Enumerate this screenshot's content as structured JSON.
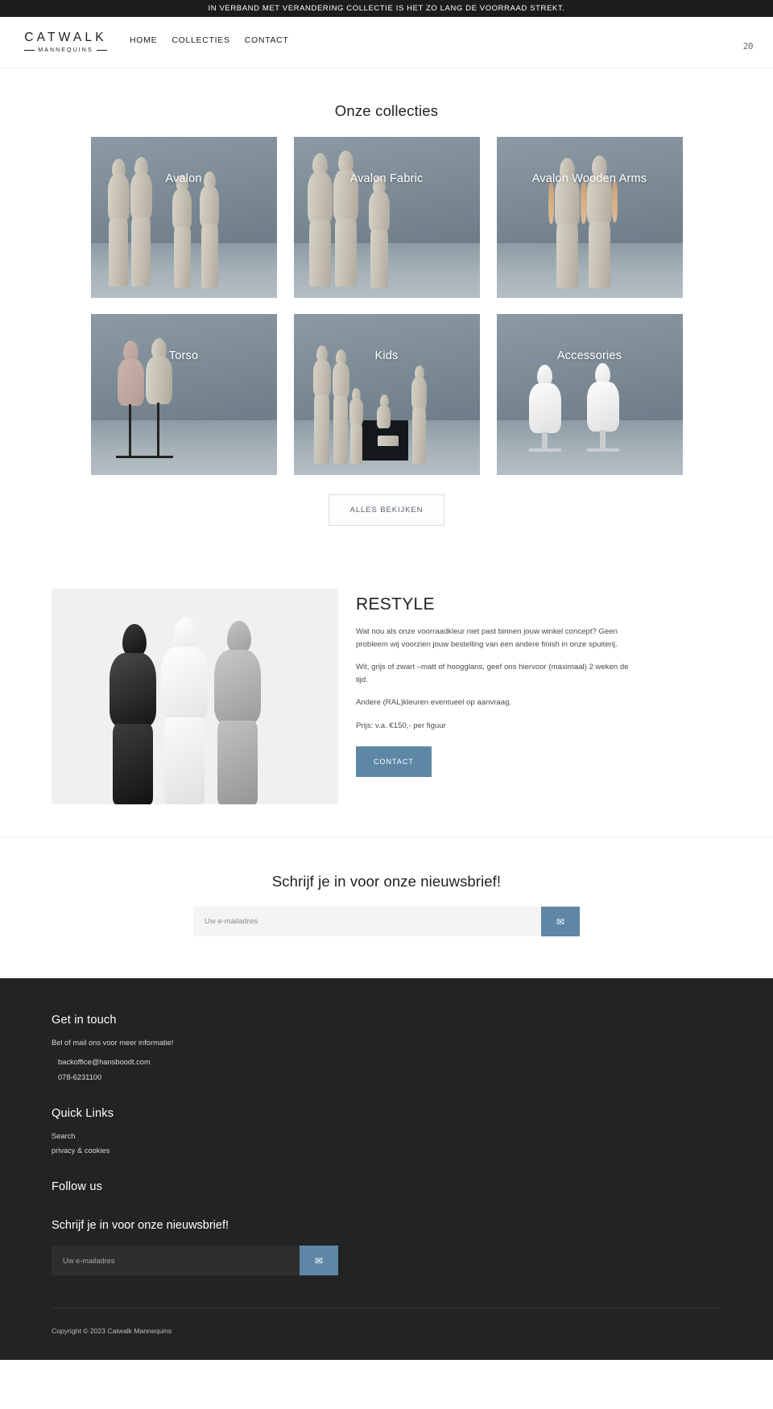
{
  "announcement": {
    "text": "IN VERBAND MET VERANDERING COLLECTIE IS HET ZO LANG DE VOORRAAD STREKT."
  },
  "header": {
    "logo_main": "CATWALK",
    "logo_sub": "MANNEQUINS",
    "nav": [
      {
        "label": "HOME"
      },
      {
        "label": "COLLECTIES"
      },
      {
        "label": "CONTACT"
      }
    ],
    "cart_glyph": "20"
  },
  "collections": {
    "title": "Onze collecties",
    "cards": [
      {
        "label": "Avalon"
      },
      {
        "label": "Avalon Fabric"
      },
      {
        "label": "Avalon Wooden Arms"
      },
      {
        "label": "Torso"
      },
      {
        "label": "Kids"
      },
      {
        "label": "Accessories"
      }
    ],
    "view_all_label": "ALLES BEKIJKEN"
  },
  "restyle": {
    "title": "RESTYLE",
    "paragraphs": [
      "Wat nou als onze voorraadkleur niet past binnen jouw winkel concept? Geen probleem wij voorzien jouw bestelling van een andere finish in onze spuiterij.",
      "Wit, grijs of zwart –matt of hoogglans, geef ons hiervoor (maximaal) 2 weken de tijd.",
      "Andere (RAL)kleuren eventueel op aanvraag.",
      "Prijs: v.a. €150,- per figuur"
    ],
    "button_label": "CONTACT"
  },
  "newsletter": {
    "title": "Schrijf je in voor onze nieuwsbrief!",
    "placeholder": "Uw e-mailadres",
    "value": "",
    "submit_icon": "✉"
  },
  "footer": {
    "get_in_touch": {
      "heading": "Get in touch",
      "subtitle": "Bel of mail ons voor meer informatie!",
      "email": "backoffice@hansboodt.com",
      "phone": "078-6231100"
    },
    "quick_links": {
      "heading": "Quick Links",
      "links": [
        {
          "label": "Search"
        },
        {
          "label": "privacy & cookies"
        }
      ]
    },
    "follow_us": {
      "heading": "Follow us"
    },
    "newsletter": {
      "title": "Schrijf je in voor onze nieuwsbrief!",
      "placeholder": "Uw e-mailadres",
      "value": "",
      "submit_icon": "✉"
    },
    "copyright": "Copyright © 2023 Catwalk Mannequins"
  },
  "colors": {
    "accent": "#5e87a6",
    "dark": "#232323",
    "bar": "#1c1c1c"
  }
}
